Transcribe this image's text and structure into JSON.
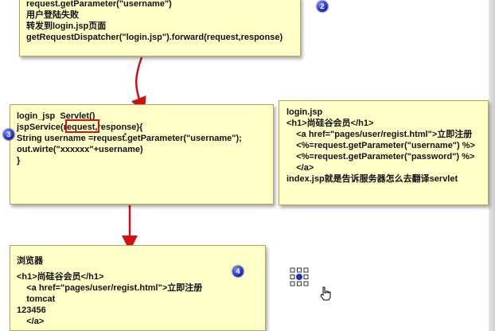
{
  "box1": {
    "lines": [
      "request.getParameter(\"username\")",
      "用户登陆失败",
      "转发到login.jsp页面",
      "getRequestDispatcher(\"login.jsp\").forward(request,response)"
    ],
    "badge": "2"
  },
  "box2": {
    "lines": [
      "login_jsp  Servlet()",
      "jspService(request,response){",
      "",
      "String username =request.getParameter(\"username\");",
      "out.wirte(\"xxxxxx\"+username)",
      "",
      "",
      "}"
    ],
    "badge": "3",
    "highlighted_word": "request"
  },
  "box3": {
    "lines": [
      "login.jsp",
      "<h1>尚硅谷会员</h1>",
      "    <a href=\"pages/user/regist.html\">立即注册",
      "    <%=request.getParameter(\"username\") %>",
      "    <%=request.getParameter(\"password\") %>",
      "    </a>",
      "",
      "index.jsp就是告诉服务器怎么去翻译servlet"
    ]
  },
  "box4": {
    "lines": [
      "浏览器",
      "",
      "<h1>尚硅谷会员</h1>",
      "    <a href=\"pages/user/regist.html\">立即注册",
      "    tomcat",
      "123456",
      "    </a>"
    ],
    "badge": "4"
  },
  "colors": {
    "note_background": "#ffffc8",
    "arrow": "#d11111",
    "badge": "#2230c9"
  },
  "icons": [
    "grid-icon",
    "mouse-pointer-icon"
  ]
}
